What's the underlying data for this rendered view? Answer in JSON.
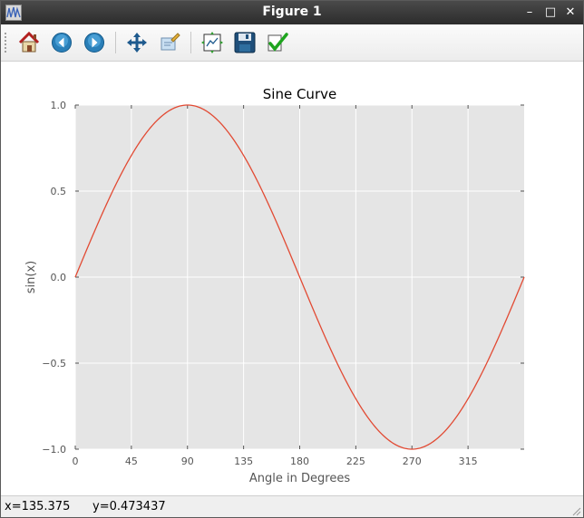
{
  "window": {
    "title": "Figure 1",
    "controls": {
      "minimize": "–",
      "maximize": "□",
      "close": "✕"
    }
  },
  "toolbar": {
    "buttons": [
      {
        "id": "home",
        "icon": "home-icon"
      },
      {
        "id": "back",
        "icon": "back-arrow-icon"
      },
      {
        "id": "forward",
        "icon": "forward-arrow-icon"
      },
      {
        "id": "pan",
        "icon": "pan-move-icon"
      },
      {
        "id": "zoom",
        "icon": "zoom-rect-icon"
      },
      {
        "id": "subplots",
        "icon": "subplots-config-icon"
      },
      {
        "id": "save",
        "icon": "save-disk-icon"
      },
      {
        "id": "edit",
        "icon": "check-icon"
      }
    ]
  },
  "status": {
    "x_text": "x=135.375",
    "y_text": "y=0.473437"
  },
  "colors": {
    "line": "#e24a33",
    "axes_bg": "#e5e5e5",
    "grid": "#ffffff"
  },
  "chart_data": {
    "type": "line",
    "title": "Sine Curve",
    "xlabel": "Angle in Degrees",
    "ylabel": "sin(x)",
    "xlim": [
      0,
      360
    ],
    "ylim": [
      -1.0,
      1.0
    ],
    "xticks": [
      0,
      45,
      90,
      135,
      180,
      225,
      270,
      315
    ],
    "xtick_labels": [
      "0",
      "45",
      "90",
      "135",
      "180",
      "225",
      "270",
      "315"
    ],
    "yticks": [
      1.0,
      0.5,
      0.0,
      -0.5,
      -1.0
    ],
    "ytick_labels": [
      "1.0",
      "0.5",
      "0.0",
      "−0.5",
      "−1.0"
    ],
    "grid": true,
    "series": [
      {
        "function": "sin(x)",
        "x_range": [
          0,
          360
        ],
        "step": 1
      }
    ]
  }
}
